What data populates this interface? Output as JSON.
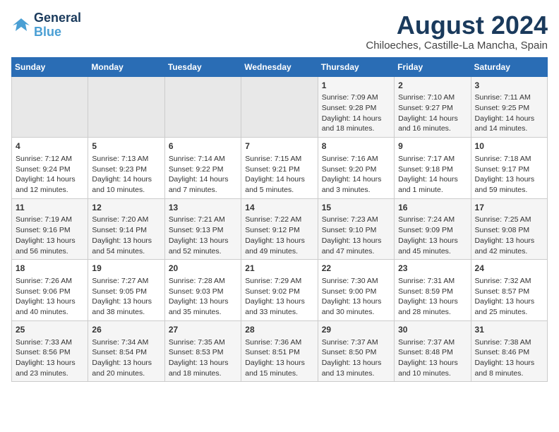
{
  "logo": {
    "line1": "General",
    "line2": "Blue"
  },
  "title": "August 2024",
  "subtitle": "Chiloeches, Castille-La Mancha, Spain",
  "days_header": [
    "Sunday",
    "Monday",
    "Tuesday",
    "Wednesday",
    "Thursday",
    "Friday",
    "Saturday"
  ],
  "weeks": [
    [
      {
        "num": "",
        "content": ""
      },
      {
        "num": "",
        "content": ""
      },
      {
        "num": "",
        "content": ""
      },
      {
        "num": "",
        "content": ""
      },
      {
        "num": "1",
        "content": "Sunrise: 7:09 AM\nSunset: 9:28 PM\nDaylight: 14 hours and 18 minutes."
      },
      {
        "num": "2",
        "content": "Sunrise: 7:10 AM\nSunset: 9:27 PM\nDaylight: 14 hours and 16 minutes."
      },
      {
        "num": "3",
        "content": "Sunrise: 7:11 AM\nSunset: 9:25 PM\nDaylight: 14 hours and 14 minutes."
      }
    ],
    [
      {
        "num": "4",
        "content": "Sunrise: 7:12 AM\nSunset: 9:24 PM\nDaylight: 14 hours and 12 minutes."
      },
      {
        "num": "5",
        "content": "Sunrise: 7:13 AM\nSunset: 9:23 PM\nDaylight: 14 hours and 10 minutes."
      },
      {
        "num": "6",
        "content": "Sunrise: 7:14 AM\nSunset: 9:22 PM\nDaylight: 14 hours and 7 minutes."
      },
      {
        "num": "7",
        "content": "Sunrise: 7:15 AM\nSunset: 9:21 PM\nDaylight: 14 hours and 5 minutes."
      },
      {
        "num": "8",
        "content": "Sunrise: 7:16 AM\nSunset: 9:20 PM\nDaylight: 14 hours and 3 minutes."
      },
      {
        "num": "9",
        "content": "Sunrise: 7:17 AM\nSunset: 9:18 PM\nDaylight: 14 hours and 1 minute."
      },
      {
        "num": "10",
        "content": "Sunrise: 7:18 AM\nSunset: 9:17 PM\nDaylight: 13 hours and 59 minutes."
      }
    ],
    [
      {
        "num": "11",
        "content": "Sunrise: 7:19 AM\nSunset: 9:16 PM\nDaylight: 13 hours and 56 minutes."
      },
      {
        "num": "12",
        "content": "Sunrise: 7:20 AM\nSunset: 9:14 PM\nDaylight: 13 hours and 54 minutes."
      },
      {
        "num": "13",
        "content": "Sunrise: 7:21 AM\nSunset: 9:13 PM\nDaylight: 13 hours and 52 minutes."
      },
      {
        "num": "14",
        "content": "Sunrise: 7:22 AM\nSunset: 9:12 PM\nDaylight: 13 hours and 49 minutes."
      },
      {
        "num": "15",
        "content": "Sunrise: 7:23 AM\nSunset: 9:10 PM\nDaylight: 13 hours and 47 minutes."
      },
      {
        "num": "16",
        "content": "Sunrise: 7:24 AM\nSunset: 9:09 PM\nDaylight: 13 hours and 45 minutes."
      },
      {
        "num": "17",
        "content": "Sunrise: 7:25 AM\nSunset: 9:08 PM\nDaylight: 13 hours and 42 minutes."
      }
    ],
    [
      {
        "num": "18",
        "content": "Sunrise: 7:26 AM\nSunset: 9:06 PM\nDaylight: 13 hours and 40 minutes."
      },
      {
        "num": "19",
        "content": "Sunrise: 7:27 AM\nSunset: 9:05 PM\nDaylight: 13 hours and 38 minutes."
      },
      {
        "num": "20",
        "content": "Sunrise: 7:28 AM\nSunset: 9:03 PM\nDaylight: 13 hours and 35 minutes."
      },
      {
        "num": "21",
        "content": "Sunrise: 7:29 AM\nSunset: 9:02 PM\nDaylight: 13 hours and 33 minutes."
      },
      {
        "num": "22",
        "content": "Sunrise: 7:30 AM\nSunset: 9:00 PM\nDaylight: 13 hours and 30 minutes."
      },
      {
        "num": "23",
        "content": "Sunrise: 7:31 AM\nSunset: 8:59 PM\nDaylight: 13 hours and 28 minutes."
      },
      {
        "num": "24",
        "content": "Sunrise: 7:32 AM\nSunset: 8:57 PM\nDaylight: 13 hours and 25 minutes."
      }
    ],
    [
      {
        "num": "25",
        "content": "Sunrise: 7:33 AM\nSunset: 8:56 PM\nDaylight: 13 hours and 23 minutes."
      },
      {
        "num": "26",
        "content": "Sunrise: 7:34 AM\nSunset: 8:54 PM\nDaylight: 13 hours and 20 minutes."
      },
      {
        "num": "27",
        "content": "Sunrise: 7:35 AM\nSunset: 8:53 PM\nDaylight: 13 hours and 18 minutes."
      },
      {
        "num": "28",
        "content": "Sunrise: 7:36 AM\nSunset: 8:51 PM\nDaylight: 13 hours and 15 minutes."
      },
      {
        "num": "29",
        "content": "Sunrise: 7:37 AM\nSunset: 8:50 PM\nDaylight: 13 hours and 13 minutes."
      },
      {
        "num": "30",
        "content": "Sunrise: 7:37 AM\nSunset: 8:48 PM\nDaylight: 13 hours and 10 minutes."
      },
      {
        "num": "31",
        "content": "Sunrise: 7:38 AM\nSunset: 8:46 PM\nDaylight: 13 hours and 8 minutes."
      }
    ]
  ]
}
